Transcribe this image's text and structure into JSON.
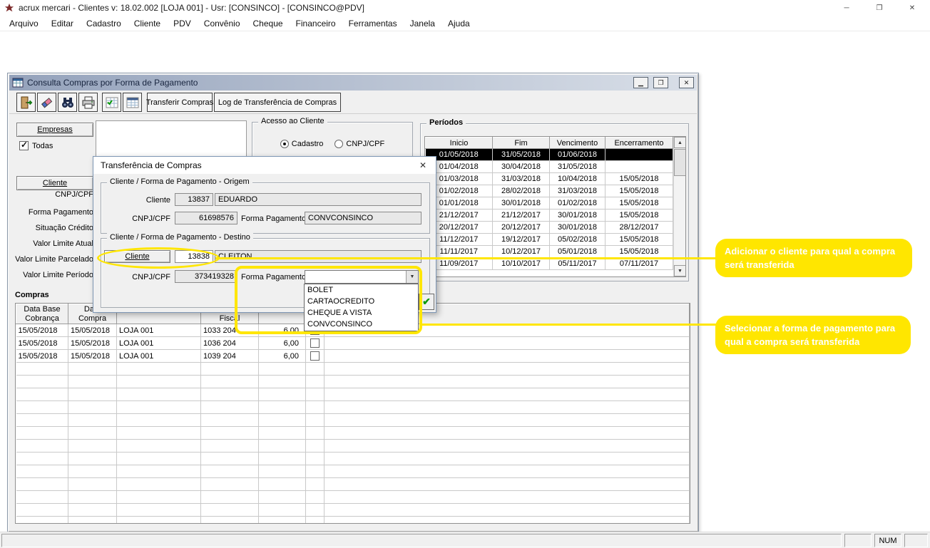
{
  "colors": {
    "annotation_yellow": "#ffe600",
    "selection_bg": "#000000",
    "selection_fg": "#ffffff",
    "child_titlebar": "#94a2bb"
  },
  "window": {
    "title": "acrux mercari - Clientes  v: 18.02.002   [LOJA 001] - Usr: [CONSINCO] - [CONSINCO@PDV]",
    "menus": [
      "Arquivo",
      "Editar",
      "Cadastro",
      "Cliente",
      "PDV",
      "Convênio",
      "Cheque",
      "Financeiro",
      "Ferramentas",
      "Janela",
      "Ajuda"
    ]
  },
  "child_window": {
    "title": "Consulta Compras por Forma de Pagamento",
    "toolbar": {
      "icons": [
        "exit-icon",
        "eraser-icon",
        "search-binoculars-icon",
        "print-icon",
        "grid-check-icon",
        "grid-icon"
      ],
      "transferir_label": "Transferir Compras",
      "log_label": "Log de Transferência de Compras"
    }
  },
  "left_panel": {
    "empresas_label": "Empresas",
    "todas_label": "Todas",
    "cliente_label": "Cliente",
    "field_labels": [
      "CNPJ/CPF",
      "Forma Pagamento",
      "Situação Crédito",
      "Valor Limite Atual",
      "Valor Limite Parcelado",
      "Valor Limite Período"
    ]
  },
  "acesso": {
    "title": "Acesso ao Cliente",
    "option1": "Cadastro",
    "option2": "CNPJ/CPF",
    "selected": "Cadastro"
  },
  "periodos": {
    "title": "Períodos",
    "columns": [
      "Inicio",
      "Fim",
      "Vencimento",
      "Encerramento"
    ],
    "selected_index": 0,
    "rows": [
      [
        "01/05/2018",
        "31/05/2018",
        "01/06/2018",
        ""
      ],
      [
        "01/04/2018",
        "30/04/2018",
        "31/05/2018",
        ""
      ],
      [
        "01/03/2018",
        "31/03/2018",
        "10/04/2018",
        "15/05/2018"
      ],
      [
        "01/02/2018",
        "28/02/2018",
        "31/03/2018",
        "15/05/2018"
      ],
      [
        "01/01/2018",
        "30/01/2018",
        "01/02/2018",
        "15/05/2018"
      ],
      [
        "21/12/2017",
        "21/12/2017",
        "30/01/2018",
        "15/05/2018"
      ],
      [
        "20/12/2017",
        "20/12/2017",
        "30/01/2018",
        "28/12/2017"
      ],
      [
        "11/12/2017",
        "19/12/2017",
        "05/02/2018",
        "15/05/2018"
      ],
      [
        "11/11/2017",
        "10/12/2017",
        "05/01/2018",
        "15/05/2018"
      ],
      [
        "11/09/2017",
        "10/10/2017",
        "05/11/2017",
        "07/11/2017"
      ]
    ]
  },
  "dialog": {
    "title": "Transferência de Compras",
    "origem": {
      "group_title": "Cliente / Forma de Pagamento - Origem",
      "cliente_label": "Cliente",
      "cliente_code": "13837",
      "cliente_name": "EDUARDO",
      "cnpj_label": "CNPJ/CPF",
      "cnpj_value": "61698576",
      "forma_label": "Forma Pagamento",
      "forma_value": "CONVCONSINCO"
    },
    "destino": {
      "group_title": "Cliente / Forma de Pagamento - Destino",
      "cliente_label": "Cliente",
      "cliente_code": "13838",
      "cliente_name": "CLEITON",
      "cnpj_label": "CNPJ/CPF",
      "cnpj_value": "373419328",
      "forma_label": "Forma Pagamento",
      "forma_value": ""
    },
    "dropdown_options": [
      "BOLET",
      "CARTAOCREDITO",
      "CHEQUE A VISTA",
      "CONVCONSINCO"
    ]
  },
  "compras": {
    "title": "Compras",
    "columns": [
      [
        "Data Base",
        "Cobrança"
      ],
      [
        "Data",
        "Compra"
      ],
      [
        "",
        ""
      ],
      [
        "",
        "Fiscal"
      ],
      [
        "",
        ""
      ],
      [
        "",
        ""
      ]
    ],
    "rows": [
      [
        "15/05/2018",
        "15/05/2018",
        "LOJA 001",
        "1033 204",
        "6,00",
        "[ ]",
        ""
      ],
      [
        "15/05/2018",
        "15/05/2018",
        "LOJA 001",
        "1036 204",
        "6,00",
        "[ ]",
        ""
      ],
      [
        "15/05/2018",
        "15/05/2018",
        "LOJA 001",
        "1039 204",
        "6,00",
        "[ ]",
        ""
      ]
    ]
  },
  "annotations": {
    "callout_cliente": "Adicionar o cliente para qual a compra será transferida",
    "callout_forma": "Selecionar a forma de pagamento para qual a compra será transferida"
  },
  "statusbar": {
    "num_label": "NUM"
  }
}
